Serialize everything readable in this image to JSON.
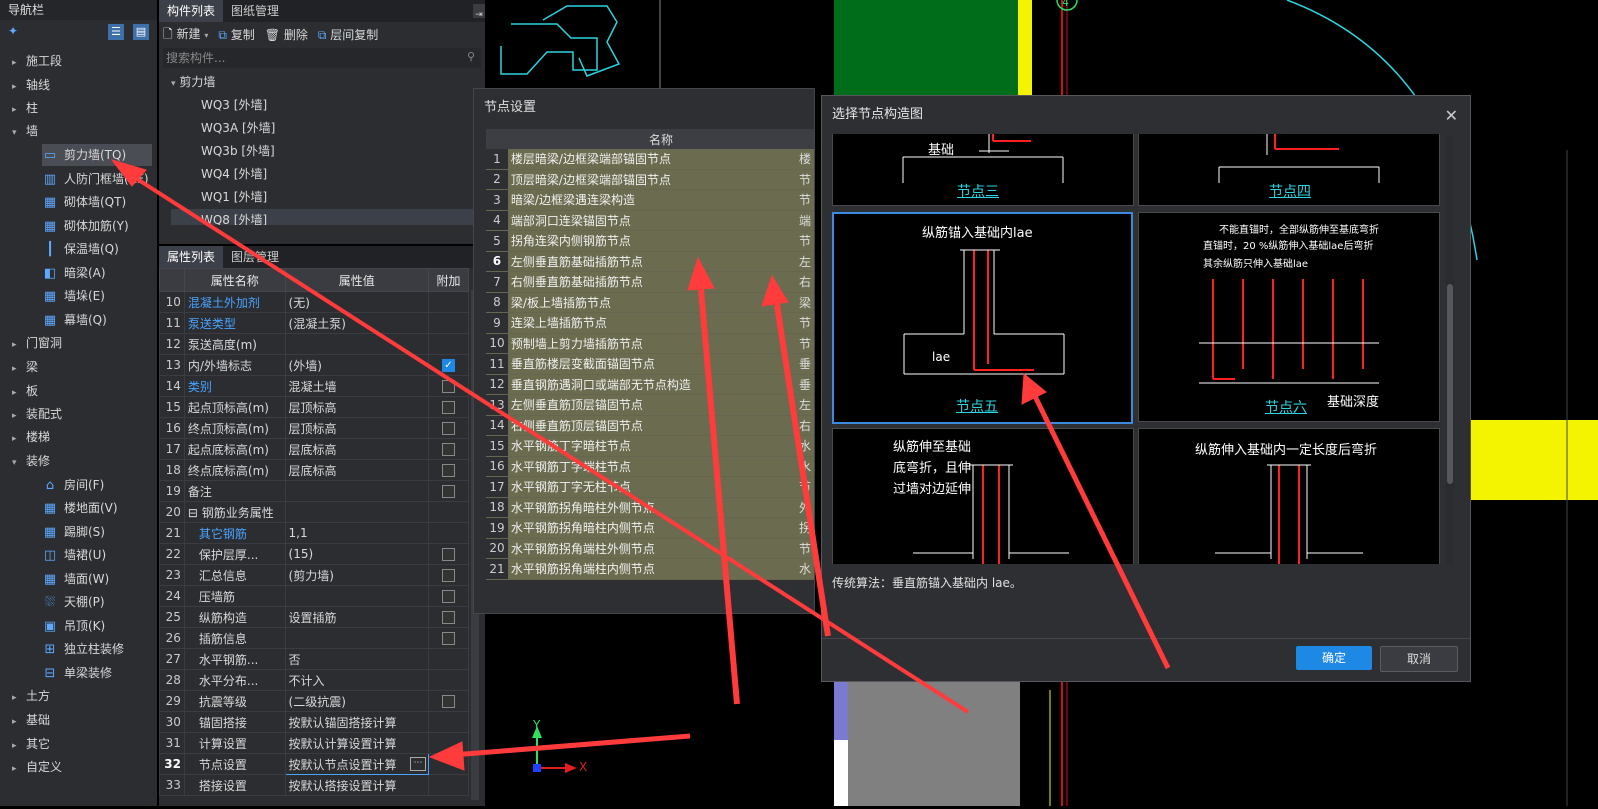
{
  "nav": {
    "title": "导航栏",
    "items": [
      {
        "label": "施工段",
        "type": "group"
      },
      {
        "label": "轴线",
        "type": "group"
      },
      {
        "label": "柱",
        "type": "group"
      },
      {
        "label": "墙",
        "type": "group-open"
      },
      {
        "label": "剪力墙(TQ)",
        "type": "leaf",
        "icon": "wall-icon",
        "selected": true
      },
      {
        "label": "人防门框墙(RF)",
        "type": "leaf",
        "icon": "door-frame-icon"
      },
      {
        "label": "砌体墙(QT)",
        "type": "leaf",
        "icon": "brick-wall-icon"
      },
      {
        "label": "砌体加筋(Y)",
        "type": "leaf",
        "icon": "rebar-icon"
      },
      {
        "label": "保温墙(Q)",
        "type": "leaf",
        "icon": "insulation-icon"
      },
      {
        "label": "暗梁(A)",
        "type": "leaf",
        "icon": "beam-icon"
      },
      {
        "label": "墙垛(E)",
        "type": "leaf",
        "icon": "pier-icon"
      },
      {
        "label": "幕墙(Q)",
        "type": "leaf",
        "icon": "curtain-wall-icon"
      },
      {
        "label": "门窗洞",
        "type": "group"
      },
      {
        "label": "梁",
        "type": "group"
      },
      {
        "label": "板",
        "type": "group"
      },
      {
        "label": "装配式",
        "type": "group"
      },
      {
        "label": "楼梯",
        "type": "group"
      },
      {
        "label": "装修",
        "type": "group-open"
      },
      {
        "label": "房间(F)",
        "type": "leaf",
        "icon": "room-icon"
      },
      {
        "label": "楼地面(V)",
        "type": "leaf",
        "icon": "floor-icon"
      },
      {
        "label": "踢脚(S)",
        "type": "leaf",
        "icon": "skirting-icon"
      },
      {
        "label": "墙裙(U)",
        "type": "leaf",
        "icon": "dado-icon"
      },
      {
        "label": "墙面(W)",
        "type": "leaf",
        "icon": "wall-surface-icon"
      },
      {
        "label": "天棚(P)",
        "type": "leaf",
        "icon": "ceiling-icon"
      },
      {
        "label": "吊顶(K)",
        "type": "leaf",
        "icon": "suspended-ceiling-icon"
      },
      {
        "label": "独立柱装修",
        "type": "leaf",
        "icon": "column-finish-icon"
      },
      {
        "label": "单梁装修",
        "type": "leaf",
        "icon": "beam-finish-icon"
      },
      {
        "label": "土方",
        "type": "group"
      },
      {
        "label": "基础",
        "type": "group"
      },
      {
        "label": "其它",
        "type": "group"
      },
      {
        "label": "自定义",
        "type": "group"
      }
    ]
  },
  "component": {
    "tabs": [
      "构件列表",
      "图纸管理"
    ],
    "toolbar": {
      "new": "新建",
      "copy": "复制",
      "delete": "删除",
      "floor_copy": "层间复制"
    },
    "search_placeholder": "搜索构件...",
    "tree_root": "剪力墙",
    "items": [
      "WQ3 [外墙]",
      "WQ3A [外墙]",
      "WQ3b [外墙]",
      "WQ4 [外墙]",
      "WQ1 [外墙]",
      "WQ8 [外墙]"
    ]
  },
  "props": {
    "tabs": [
      "属性列表",
      "图层管理"
    ],
    "headers": [
      "属性名称",
      "属性值",
      "附加"
    ],
    "rows": [
      {
        "n": "10",
        "name": "混凝土外加剂",
        "value": "(无)",
        "blue": true,
        "cb": ""
      },
      {
        "n": "11",
        "name": "泵送类型",
        "value": "(混凝土泵)",
        "blue": true,
        "cb": ""
      },
      {
        "n": "12",
        "name": "泵送高度(m)",
        "value": "",
        "cb": ""
      },
      {
        "n": "13",
        "name": "内/外墙标志",
        "value": "(外墙)",
        "cb": "on"
      },
      {
        "n": "14",
        "name": "类别",
        "value": "混凝土墙",
        "blue": true,
        "cb": "off"
      },
      {
        "n": "15",
        "name": "起点顶标高(m)",
        "value": "层顶标高",
        "cb": "off"
      },
      {
        "n": "16",
        "name": "终点顶标高(m)",
        "value": "层顶标高",
        "cb": "off"
      },
      {
        "n": "17",
        "name": "起点底标高(m)",
        "value": "层底标高",
        "cb": "off"
      },
      {
        "n": "18",
        "name": "终点底标高(m)",
        "value": "层底标高",
        "cb": "off"
      },
      {
        "n": "19",
        "name": "备注",
        "value": "",
        "cb": "off"
      },
      {
        "n": "20",
        "name": "⊟ 钢筋业务属性",
        "value": "",
        "cb": ""
      },
      {
        "n": "21",
        "name": "其它钢筋",
        "value": "1,1",
        "blue": true,
        "indent": true,
        "cb": ""
      },
      {
        "n": "22",
        "name": "保护层厚...",
        "value": "(15)",
        "indent": true,
        "cb": "off"
      },
      {
        "n": "23",
        "name": "汇总信息",
        "value": "(剪力墙)",
        "indent": true,
        "cb": "off"
      },
      {
        "n": "24",
        "name": "压墙筋",
        "value": "",
        "indent": true,
        "cb": "off"
      },
      {
        "n": "25",
        "name": "纵筋构造",
        "value": "设置插筋",
        "indent": true,
        "cb": "off"
      },
      {
        "n": "26",
        "name": "插筋信息",
        "value": "",
        "indent": true,
        "cb": "off"
      },
      {
        "n": "27",
        "name": "水平钢筋...",
        "value": "否",
        "indent": true,
        "cb": ""
      },
      {
        "n": "28",
        "name": "水平分布...",
        "value": "不计入",
        "indent": true,
        "cb": ""
      },
      {
        "n": "29",
        "name": "抗震等级",
        "value": "(二级抗震)",
        "indent": true,
        "cb": "off"
      },
      {
        "n": "30",
        "name": "锚固搭接",
        "value": "按默认锚固搭接计算",
        "indent": true,
        "cb": ""
      },
      {
        "n": "31",
        "name": "计算设置",
        "value": "按默认计算设置计算",
        "indent": true,
        "cb": ""
      },
      {
        "n": "32",
        "name": "节点设置",
        "value": "按默认节点设置计算",
        "indent": true,
        "bold": true,
        "edit": true,
        "cb": ""
      },
      {
        "n": "33",
        "name": "搭接设置",
        "value": "按默认搭接设置计算",
        "indent": true,
        "cb": ""
      }
    ]
  },
  "node_dialog": {
    "title": "节点设置",
    "header": "名称",
    "rows": [
      {
        "n": "1",
        "name": "楼层暗梁/边框梁端部锚固节点",
        "x": "楼"
      },
      {
        "n": "2",
        "name": "顶层暗梁/边框梁端部锚固节点",
        "x": "节"
      },
      {
        "n": "3",
        "name": "暗梁/边框梁遇连梁构造",
        "x": "节"
      },
      {
        "n": "4",
        "name": "端部洞口连梁锚固节点",
        "x": "端"
      },
      {
        "n": "5",
        "name": "拐角连梁内侧钢筋节点",
        "x": "节"
      },
      {
        "n": "6",
        "name": "左侧垂直筋基础插筋节点",
        "x": "左"
      },
      {
        "n": "7",
        "name": "右侧垂直筋基础插筋节点",
        "x": "右"
      },
      {
        "n": "8",
        "name": "梁/板上墙插筋节点",
        "x": "梁"
      },
      {
        "n": "9",
        "name": "连梁上墙插筋节点",
        "x": "节"
      },
      {
        "n": "10",
        "name": "预制墙上剪力墙插筋节点",
        "x": "节"
      },
      {
        "n": "11",
        "name": "垂直筋楼层变截面锚固节点",
        "x": "垂"
      },
      {
        "n": "12",
        "name": "垂直钢筋遇洞口或端部无节点构造",
        "x": "垂"
      },
      {
        "n": "13",
        "name": "左侧垂直筋顶层锚固节点",
        "x": "左"
      },
      {
        "n": "14",
        "name": "右侧垂直筋顶层锚固节点",
        "x": "右"
      },
      {
        "n": "15",
        "name": "水平钢筋丁字暗柱节点",
        "x": "水"
      },
      {
        "n": "16",
        "name": "水平钢筋丁字端柱节点",
        "x": "水"
      },
      {
        "n": "17",
        "name": "水平钢筋丁字无柱节点",
        "x": "节"
      },
      {
        "n": "18",
        "name": "水平钢筋拐角暗柱外侧节点",
        "x": "外"
      },
      {
        "n": "19",
        "name": "水平钢筋拐角暗柱内侧节点",
        "x": "拐"
      },
      {
        "n": "20",
        "name": "水平钢筋拐角端柱外侧节点",
        "x": "节"
      },
      {
        "n": "21",
        "name": "水平钢筋拐角端柱内侧节点",
        "x": "水"
      }
    ]
  },
  "select_dialog": {
    "title": "选择节点构造图",
    "cells": [
      {
        "caption": "节点三",
        "label": "基础"
      },
      {
        "caption": "节点四",
        "label": ""
      },
      {
        "caption": "节点五",
        "label": "纵筋锚入基础内lae",
        "sub": "lae"
      },
      {
        "caption": "节点六",
        "label": "基础深度",
        "notes": [
          "不能直锚时，全部纵筋伸至基底弯折",
          "直锚时，20 %纵筋伸入基础lae后弯折",
          "其余纵筋只伸入基础lae"
        ]
      },
      {
        "caption": "",
        "label": "纵筋伸至基础底弯折，且伸过墙对边延伸"
      },
      {
        "caption": "",
        "label": "纵筋伸入基础内一定长度后弯折"
      }
    ],
    "description": "传统算法：垂直筋锚入基础内 lae。",
    "ok": "确定",
    "cancel": "取消"
  },
  "cad": {
    "axis_number": "4",
    "x_label": "X",
    "y_label": "Y"
  },
  "colors": {
    "accent": "#1e88e5",
    "arrow": "#ff3b3b",
    "drawing_red": "#ff2020",
    "caption": "#2ad4e0",
    "cad_green": "#006d1b",
    "cad_yellow": "#f4f400"
  }
}
